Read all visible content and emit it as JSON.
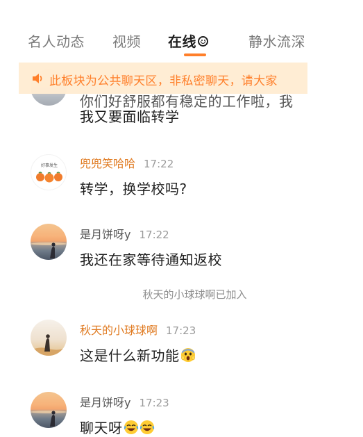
{
  "tabs": {
    "items": [
      {
        "label": "名人动态"
      },
      {
        "label": "视频"
      },
      {
        "label": "在线"
      },
      {
        "label": "静水流深"
      }
    ],
    "active_index": 2,
    "active_icon": "smile-icon",
    "accent_color": "#ff7f2a"
  },
  "notice": {
    "icon": "speaker-icon",
    "text": "此板块为公共聊天区，非私密聊天，请大家"
  },
  "messages": [
    {
      "type": "partial",
      "partial_text": "你们好舒服都有稳定的工作啦，我",
      "text": "我又要面临转学"
    },
    {
      "type": "message",
      "sender": "兜兜笑哈哈",
      "time": "17:22",
      "text": "转学，换学校吗?",
      "avatar": "oranges-avatar",
      "avatar_caption": "好事发生"
    },
    {
      "type": "message",
      "sender": "是月饼呀y",
      "time": "17:22",
      "text": "我还在家等待通知返校",
      "avatar": "sunset-avatar"
    },
    {
      "type": "system",
      "text": "秋天的小球球啊已加入"
    },
    {
      "type": "message",
      "sender": "秋天的小球球啊",
      "time": "17:23",
      "text": "这是什么新功能",
      "emojis": [
        "scream-emoji"
      ],
      "avatar": "beige-avatar"
    },
    {
      "type": "message",
      "sender": "是月饼呀y",
      "time": "17:23",
      "text": "聊天呀",
      "emojis": [
        "laugh-cry-emoji",
        "laugh-cry-emoji"
      ],
      "avatar": "sunset-avatar"
    }
  ],
  "colors": {
    "sender_orange": "#e07b22",
    "sender_gray": "#555555",
    "time_gray": "#9a9a9a",
    "notice_bg": "#ffecd2",
    "notice_text": "#ff7f2a"
  }
}
